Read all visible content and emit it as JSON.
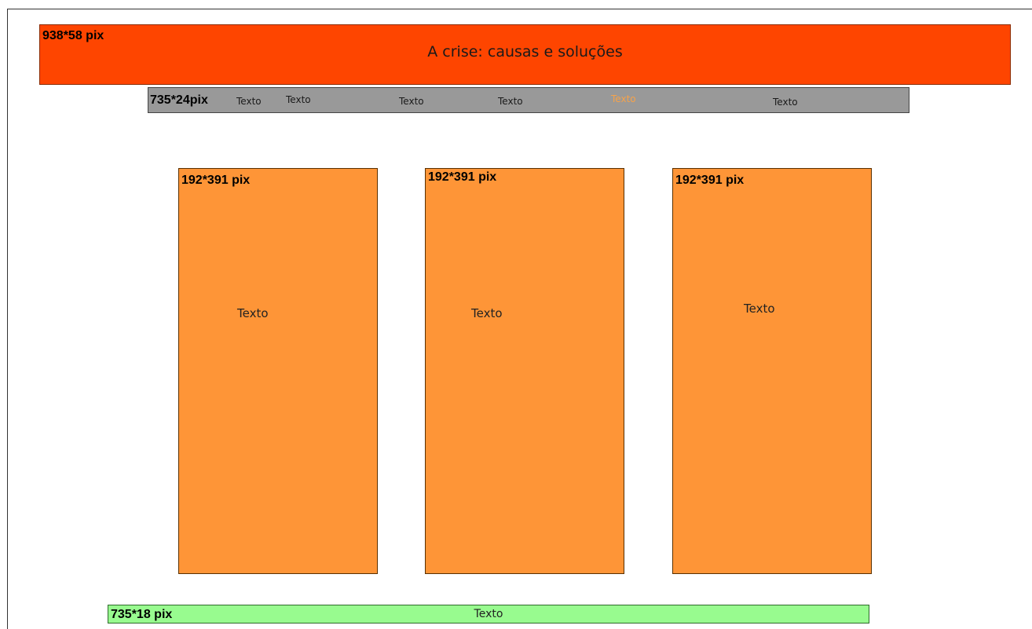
{
  "header": {
    "dimension_label": "938*58 pix",
    "title": "A crise: causas e soluções",
    "color": "#fe4500"
  },
  "navbar": {
    "dimension_label": "735*24pix",
    "color": "#999999",
    "items": [
      {
        "label": "Texto",
        "active": false
      },
      {
        "label": "Texto",
        "active": false
      },
      {
        "label": "Texto",
        "active": false
      },
      {
        "label": "Texto",
        "active": false
      },
      {
        "label": "Texto",
        "active": true
      },
      {
        "label": "Texto",
        "active": false
      }
    ]
  },
  "columns": [
    {
      "dimension_label": "192*391 pix",
      "text": "Texto"
    },
    {
      "dimension_label": "192*391 pix",
      "text": "Texto"
    },
    {
      "dimension_label": "192*391 pix",
      "text": "Texto"
    }
  ],
  "column_color": "#fe9537",
  "footer": {
    "dimension_label": "735*18 pix",
    "text": "Texto",
    "color": "#98fb8f"
  }
}
